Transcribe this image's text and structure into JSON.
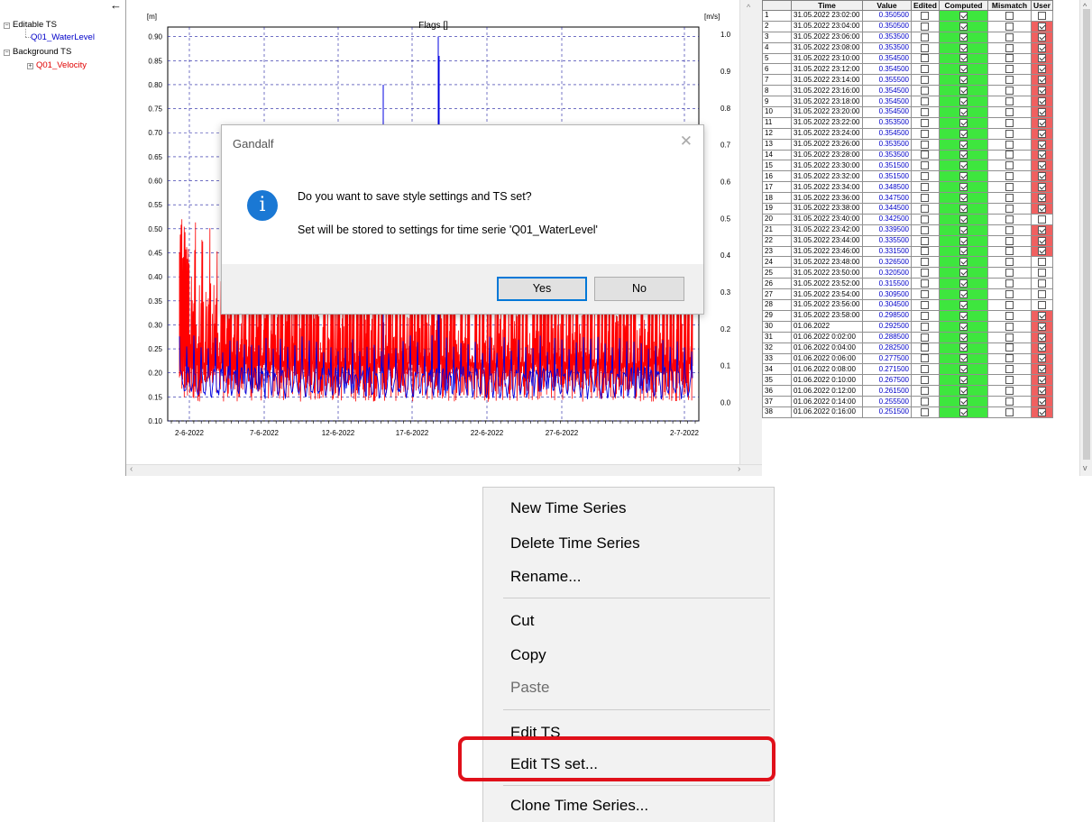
{
  "tree": {
    "back_arrow": "←",
    "editable_label": "Editable TS",
    "editable_child": "Q01_WaterLevel",
    "background_label": "Background TS",
    "background_child": "Q01_Velocity"
  },
  "chart_data": {
    "type": "line",
    "title": "Flags []",
    "y_left_unit": "[m]",
    "y_right_unit": "[m/s]",
    "y_left_ticks": [
      "0.90",
      "0.85",
      "0.80",
      "0.75",
      "0.70",
      "0.65",
      "0.60",
      "0.55",
      "0.50",
      "0.45",
      "0.40",
      "0.35",
      "0.30",
      "0.25",
      "0.20",
      "0.15",
      "0.10"
    ],
    "y_right_ticks": [
      "1.0",
      "0.9",
      "0.8",
      "0.7",
      "0.6",
      "0.5",
      "0.4",
      "0.3",
      "0.2",
      "0.1",
      "0.0"
    ],
    "x_ticks": [
      "2-6-2022",
      "7-6-2022",
      "12-6-2022",
      "17-6-2022",
      "22-6-2022",
      "27-6-2022",
      "2-7-2022"
    ],
    "ylim_left": [
      0.1,
      0.92
    ],
    "ylim_right": [
      -0.05,
      1.02
    ],
    "grid": true,
    "series": [
      {
        "name": "Q01_WaterLevel",
        "color": "#0000e0"
      },
      {
        "name": "Q01_Velocity",
        "color": "#ff0000"
      }
    ]
  },
  "table": {
    "headers": [
      "",
      "Time",
      "Value",
      "Edited",
      "Computed",
      "Mismatch",
      "User"
    ],
    "rows": [
      {
        "n": "1",
        "t": "31.05.2022 23:02:00",
        "v": "0.350500",
        "u": false
      },
      {
        "n": "2",
        "t": "31.05.2022 23:04:00",
        "v": "0.350500",
        "u": true
      },
      {
        "n": "3",
        "t": "31.05.2022 23:06:00",
        "v": "0.353500",
        "u": true
      },
      {
        "n": "4",
        "t": "31.05.2022 23:08:00",
        "v": "0.353500",
        "u": true
      },
      {
        "n": "5",
        "t": "31.05.2022 23:10:00",
        "v": "0.354500",
        "u": true
      },
      {
        "n": "6",
        "t": "31.05.2022 23:12:00",
        "v": "0.354500",
        "u": true
      },
      {
        "n": "7",
        "t": "31.05.2022 23:14:00",
        "v": "0.355500",
        "u": true
      },
      {
        "n": "8",
        "t": "31.05.2022 23:16:00",
        "v": "0.354500",
        "u": true
      },
      {
        "n": "9",
        "t": "31.05.2022 23:18:00",
        "v": "0.354500",
        "u": true
      },
      {
        "n": "10",
        "t": "31.05.2022 23:20:00",
        "v": "0.354500",
        "u": true
      },
      {
        "n": "11",
        "t": "31.05.2022 23:22:00",
        "v": "0.353500",
        "u": true
      },
      {
        "n": "12",
        "t": "31.05.2022 23:24:00",
        "v": "0.354500",
        "u": true
      },
      {
        "n": "13",
        "t": "31.05.2022 23:26:00",
        "v": "0.353500",
        "u": true
      },
      {
        "n": "14",
        "t": "31.05.2022 23:28:00",
        "v": "0.353500",
        "u": true
      },
      {
        "n": "15",
        "t": "31.05.2022 23:30:00",
        "v": "0.351500",
        "u": true
      },
      {
        "n": "16",
        "t": "31.05.2022 23:32:00",
        "v": "0.351500",
        "u": true
      },
      {
        "n": "17",
        "t": "31.05.2022 23:34:00",
        "v": "0.348500",
        "u": true
      },
      {
        "n": "18",
        "t": "31.05.2022 23:36:00",
        "v": "0.347500",
        "u": true
      },
      {
        "n": "19",
        "t": "31.05.2022 23:38:00",
        "v": "0.344500",
        "u": true
      },
      {
        "n": "20",
        "t": "31.05.2022 23:40:00",
        "v": "0.342500",
        "u": false
      },
      {
        "n": "21",
        "t": "31.05.2022 23:42:00",
        "v": "0.339500",
        "u": true
      },
      {
        "n": "22",
        "t": "31.05.2022 23:44:00",
        "v": "0.335500",
        "u": true
      },
      {
        "n": "23",
        "t": "31.05.2022 23:46:00",
        "v": "0.331500",
        "u": true
      },
      {
        "n": "24",
        "t": "31.05.2022 23:48:00",
        "v": "0.326500",
        "u": false
      },
      {
        "n": "25",
        "t": "31.05.2022 23:50:00",
        "v": "0.320500",
        "u": false
      },
      {
        "n": "26",
        "t": "31.05.2022 23:52:00",
        "v": "0.315500",
        "u": false
      },
      {
        "n": "27",
        "t": "31.05.2022 23:54:00",
        "v": "0.309500",
        "u": false
      },
      {
        "n": "28",
        "t": "31.05.2022 23:56:00",
        "v": "0.304500",
        "u": false
      },
      {
        "n": "29",
        "t": "31.05.2022 23:58:00",
        "v": "0.298500",
        "u": true
      },
      {
        "n": "30",
        "t": "01.06.2022",
        "v": "0.292500",
        "u": true
      },
      {
        "n": "31",
        "t": "01.06.2022 0:02:00",
        "v": "0.288500",
        "u": true
      },
      {
        "n": "32",
        "t": "01.06.2022 0:04:00",
        "v": "0.282500",
        "u": true
      },
      {
        "n": "33",
        "t": "01.06.2022 0:06:00",
        "v": "0.277500",
        "u": true
      },
      {
        "n": "34",
        "t": "01.06.2022 0:08:00",
        "v": "0.271500",
        "u": true
      },
      {
        "n": "35",
        "t": "01.06.2022 0:10:00",
        "v": "0.267500",
        "u": true
      },
      {
        "n": "36",
        "t": "01.06.2022 0:12:00",
        "v": "0.261500",
        "u": true
      },
      {
        "n": "37",
        "t": "01.06.2022 0:14:00",
        "v": "0.255500",
        "u": true
      },
      {
        "n": "38",
        "t": "01.06.2022 0:16:00",
        "v": "0.251500",
        "u": true
      }
    ]
  },
  "dialog": {
    "title": "Gandalf",
    "close": "✕",
    "icon": "i",
    "message": "Do you want to save style settings and TS set?",
    "detail": "Set will be stored to settings for time serie 'Q01_WaterLevel'",
    "yes": "Yes",
    "no": "No"
  },
  "context_menu": {
    "items": [
      "New Time Series",
      "Delete Time Series",
      "Rename...",
      "Cut",
      "Copy",
      "Paste",
      "Edit TS",
      "Edit TS set...",
      "Clone Time Series..."
    ],
    "disabled": [
      "Paste"
    ],
    "highlighted": "Edit TS set...",
    "highlight_color": "#e0101a"
  },
  "colors": {
    "computed_fill": "#3ee63e",
    "user_flag_fill": "#f06060",
    "value_text": "#0000c8"
  }
}
